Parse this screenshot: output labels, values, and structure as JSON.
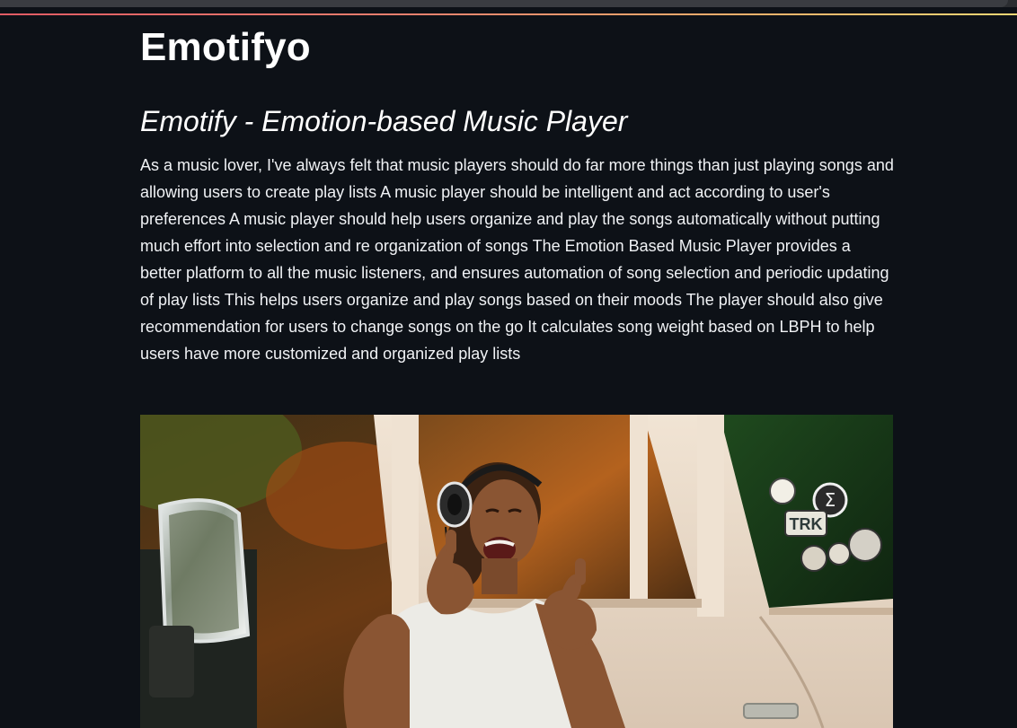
{
  "site": {
    "title": "Emotifyo"
  },
  "post": {
    "title": "Emotify - Emotion-based Music Player",
    "body": "As a music lover, I've always felt that music players should do far more things than just playing songs and allowing users to create play lists A music player should be intelligent and act according to user's preferences A music player should help users organize and play the songs automatically without putting much effort into selection and re organization of songs The Emotion Based Music Player provides a better platform to all the music listeners, and ensures automation of song selection and periodic updating of play lists This helps users organize and play songs based on their moods The player should also give recommendation for users to change songs on the go It calculates song weight based on LBPH to help users have more customized and organized play lists"
  },
  "hero_image": {
    "stickers": [
      "TRK",
      "Σ"
    ]
  },
  "colors": {
    "background": "#0d1117",
    "text": "#ffffff",
    "accent_gradient_start": "#e15b64",
    "accent_gradient_end": "#f7d774"
  }
}
